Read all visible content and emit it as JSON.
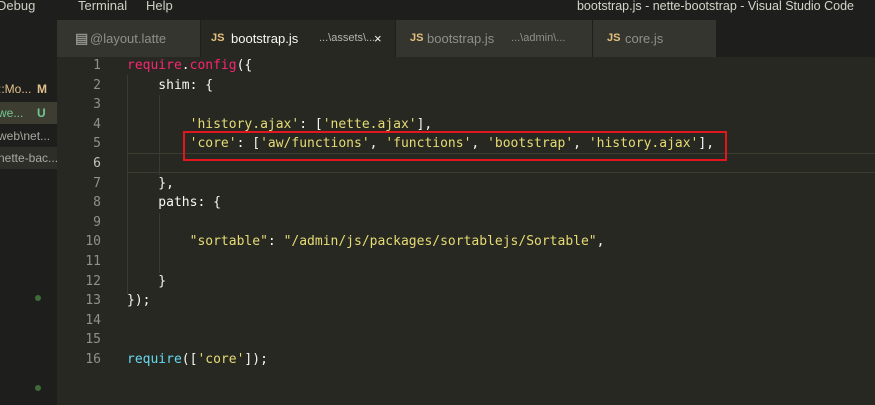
{
  "menu": {
    "debug": "Debug",
    "terminal": "Terminal",
    "help": "Help"
  },
  "window_title": "bootstrap.js - nette-bootstrap - Visual Studio Code",
  "sidebar": {
    "items": [
      {
        "name": "::Mo...",
        "badge": "M",
        "badge_color": "#e2c08d"
      },
      {
        "name": "we...",
        "badge": "U",
        "badge_color": "#73c991"
      },
      {
        "name": "web\\net...",
        "badge": ""
      },
      {
        "name": "nette-bac...",
        "badge": ""
      }
    ]
  },
  "tabs": [
    {
      "icon": "file-icon",
      "label": "@layout.latte",
      "desc": ""
    },
    {
      "icon": "JS",
      "label": "bootstrap.js",
      "desc": "...\\assets\\...",
      "close": "×"
    },
    {
      "icon": "JS",
      "label": "bootstrap.js",
      "desc": "...\\admin\\..."
    },
    {
      "icon": "JS",
      "label": "core.js",
      "desc": ""
    }
  ],
  "line_numbers": [
    "1",
    "2",
    "3",
    "4",
    "5",
    "6",
    "7",
    "8",
    "9",
    "10",
    "11",
    "12",
    "13",
    "14",
    "15",
    "16"
  ],
  "code": {
    "l1": {
      "a": "require",
      "b": ".",
      "c": "config",
      "d": "({"
    },
    "l2": {
      "a": "    shim: {"
    },
    "l4": {
      "a": "        ",
      "b": "'history.ajax'",
      "c": ": [",
      "d": "'nette.ajax'",
      "e": "],"
    },
    "l5": {
      "a": "        ",
      "b": "'core'",
      "c": ": [",
      "d": "'aw/functions'",
      "e": ", ",
      "f": "'functions'",
      "g": ", ",
      "h": "'bootstrap'",
      "i": ", ",
      "j": "'history.ajax'",
      "k": "],"
    },
    "l7": {
      "a": "    },"
    },
    "l8": {
      "a": "    paths: {"
    },
    "l10": {
      "a": "        ",
      "b": "\"sortable\"",
      "c": ": ",
      "d": "\"/admin/js/packages/sortablejs/Sortable\"",
      "e": ","
    },
    "l12": {
      "a": "    }"
    },
    "l13": {
      "a": "});"
    },
    "l16": {
      "a": "require",
      "b": "([",
      "c": "'core'",
      "d": "]);"
    }
  }
}
